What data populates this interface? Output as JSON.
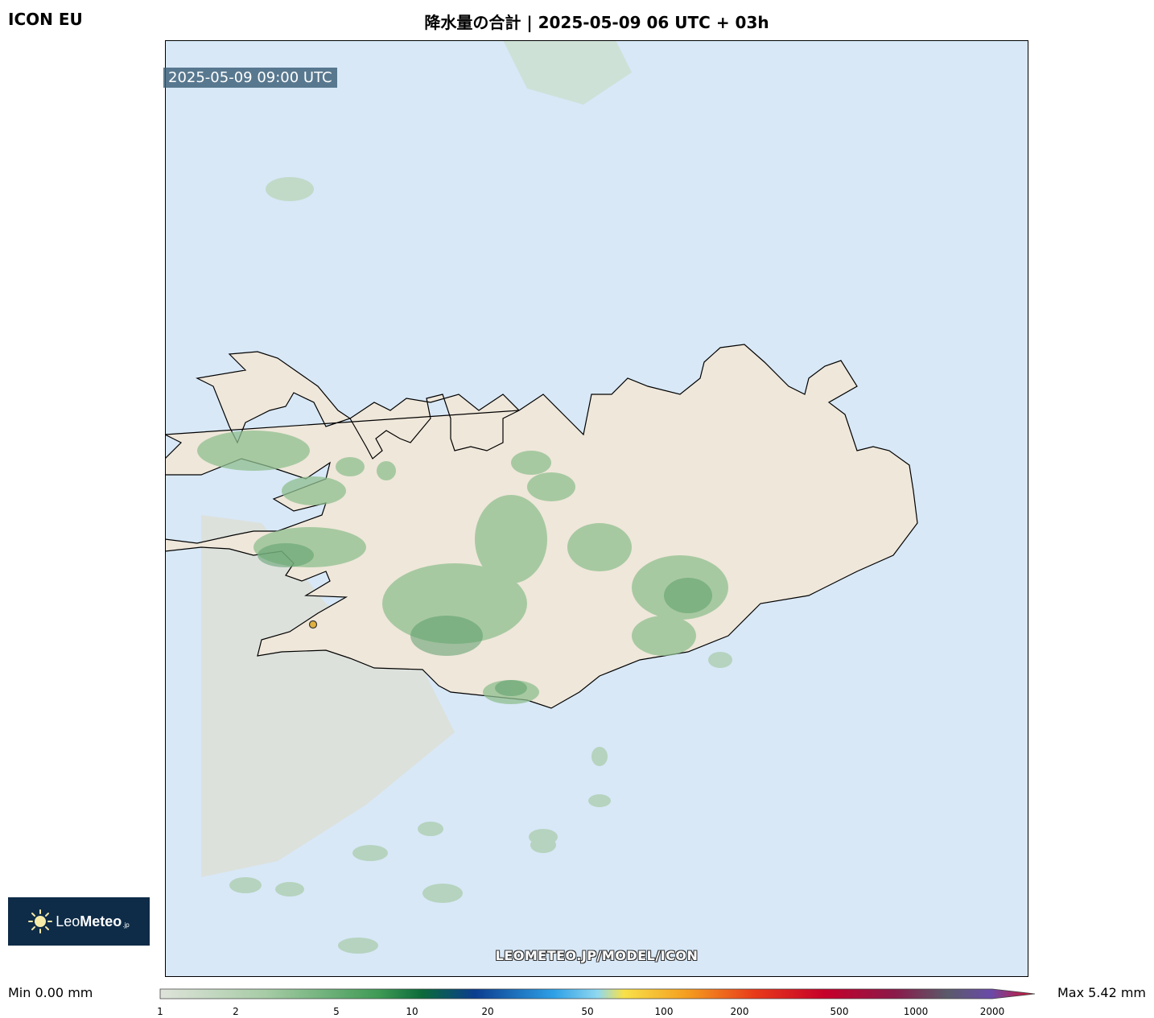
{
  "header": {
    "model_name": "ICON EU",
    "title": "降水量の合計 | 2025-05-09 06 UTC + 03h"
  },
  "map": {
    "valid_time": "2025-05-09 09:00 UTC",
    "watermark": "LEOMETEO.JP/MODEL/ICON",
    "colors": {
      "sea": "#d8e8f7",
      "land": "#efe7da",
      "rain_light": "#c5dcc0",
      "rain_mid": "#8fbf8f",
      "rain_heavy": "#5c9e6c"
    }
  },
  "logo": {
    "text_leo": "Leo",
    "text_meteo": "Meteo",
    "text_jp": ".jp",
    "icon": "sun-icon"
  },
  "legend": {
    "min_label": "Min 0.00 mm",
    "max_label": "Max 5.42 mm",
    "ticks": [
      "1",
      "2",
      "5",
      "10",
      "20",
      "50",
      "100",
      "200",
      "500",
      "1000",
      "2000"
    ]
  }
}
